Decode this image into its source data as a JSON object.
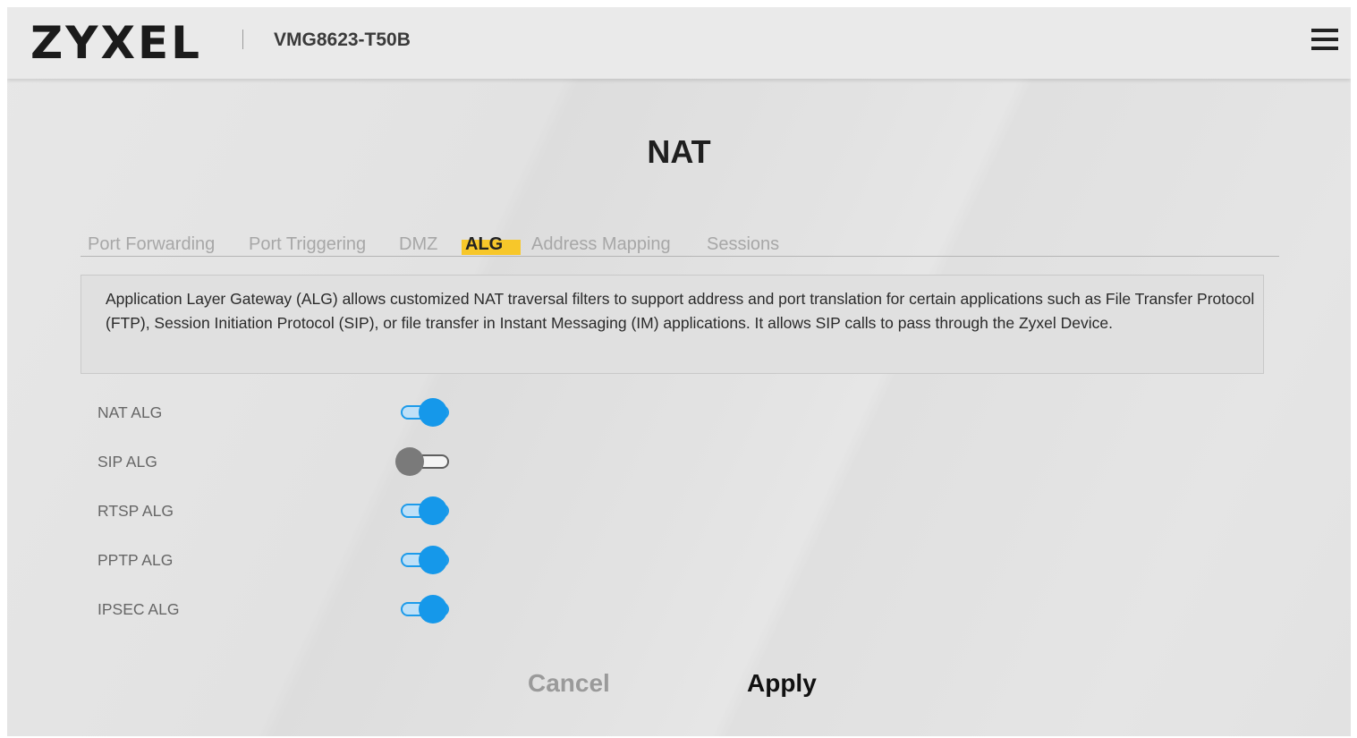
{
  "header": {
    "brand": "ZYXEL",
    "model": "VMG8623-T50B",
    "menu_icon": "hamburger-menu-icon"
  },
  "page": {
    "title": "NAT"
  },
  "tabs": [
    {
      "label": "Port Forwarding",
      "active": false
    },
    {
      "label": "Port Triggering",
      "active": false
    },
    {
      "label": "DMZ",
      "active": false
    },
    {
      "label": "ALG",
      "active": true
    },
    {
      "label": "Address Mapping",
      "active": false
    },
    {
      "label": "Sessions",
      "active": false
    }
  ],
  "description": "Application Layer Gateway (ALG) allows customized NAT traversal filters to support address and port translation for certain applications such as File Transfer Protocol (FTP), Session Initiation Protocol (SIP), or file transfer in Instant Messaging (IM) applications. It allows SIP calls to pass through the Zyxel Device.",
  "settings": [
    {
      "label": "NAT ALG",
      "enabled": true
    },
    {
      "label": "SIP ALG",
      "enabled": false
    },
    {
      "label": "RTSP ALG",
      "enabled": true
    },
    {
      "label": "PPTP ALG",
      "enabled": true
    },
    {
      "label": "IPSEC ALG",
      "enabled": true
    }
  ],
  "actions": {
    "cancel_label": "Cancel",
    "apply_label": "Apply"
  },
  "colors": {
    "accent_yellow": "#f7c72a",
    "toggle_on": "#1598ea",
    "toggle_off": "#7a7a7a"
  }
}
